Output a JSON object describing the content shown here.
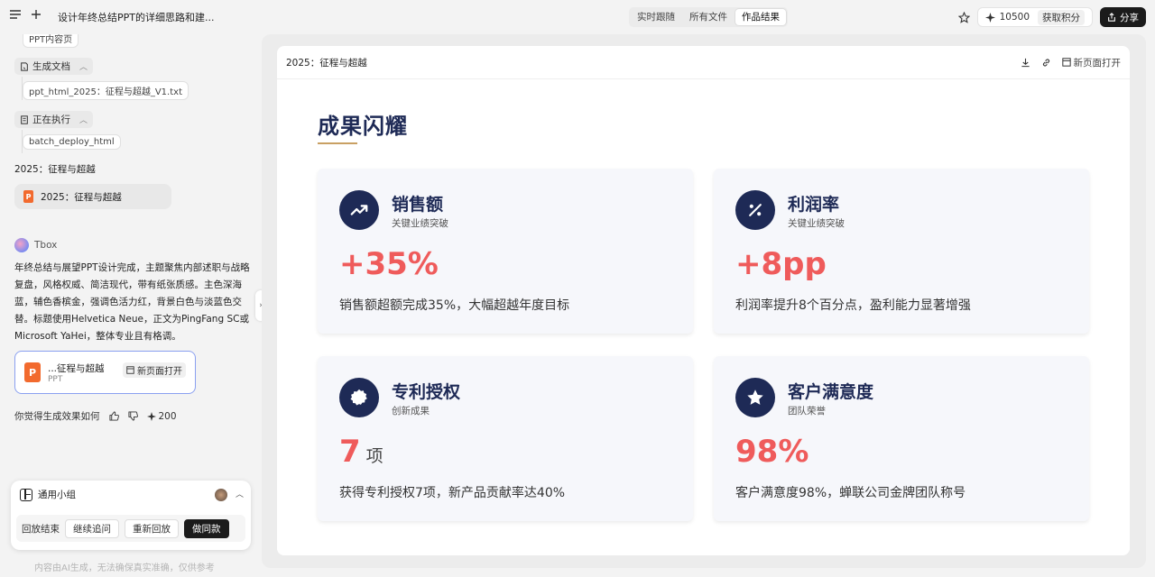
{
  "topbar": {
    "doc_title": "设计年终总结PPT的详细思路和建...",
    "tabs": [
      "实时跟随",
      "所有文件",
      "作品结果"
    ],
    "credits": "10500",
    "get_credits": "获取积分",
    "share": "分享"
  },
  "chat": {
    "top_chip": "PPT内容页",
    "step_generate": "生成文档",
    "generate_file": "ppt_html_2025：征程与超越_V1.txt",
    "step_running": "正在执行",
    "running_task": "batch_deploy_html",
    "subtitle": "2025：征程与超越",
    "ppt_item": "2025：征程与超越",
    "bot_name": "Tbox",
    "message": "年终总结与展望PPT设计完成，主题聚焦内部述职与战略复盘，风格权威、简洁现代，带有纸张质感。主色深海蓝，辅色香槟金，强调色活力红，背景白色与淡蓝色交替。标题使用Helvetica Neue，正文为PingFang SC或Microsoft YaHei，整体专业且有格调。",
    "card": {
      "name": "...征程与超越",
      "type": "PPT",
      "open": "新页面打开"
    },
    "feedback_q": "你觉得生成效果如何",
    "feedback_credits": "200",
    "replay": {
      "group": "通用小组",
      "label": "回放结束",
      "continue": "继续追问",
      "replay_again": "重新回放",
      "same": "做同款"
    },
    "disclaimer": "内容由AI生成，无法确保真实准确，仅供参考"
  },
  "viewer": {
    "title": "2025：征程与超越",
    "open_new": "新页面打开",
    "slide": {
      "heading": "成果闪耀",
      "cards": [
        {
          "name": "销售额",
          "sub": "关键业绩突破",
          "value": "+35%",
          "unit": "",
          "desc": "销售额超额完成35%，大幅超越年度目标",
          "icon": "trending-up-icon"
        },
        {
          "name": "利润率",
          "sub": "关键业绩突破",
          "value": "+8pp",
          "unit": "",
          "desc": "利润率提升8个百分点，盈利能力显著增强",
          "icon": "percent-icon"
        },
        {
          "name": "专利授权",
          "sub": "创新成果",
          "value": "7",
          "unit": "项",
          "desc": "获得专利授权7项，新产品贡献率达40%",
          "icon": "certificate-icon"
        },
        {
          "name": "客户满意度",
          "sub": "团队荣誉",
          "value": "98%",
          "unit": "",
          "desc": "客户满意度98%，蝉联公司金牌团队称号",
          "icon": "star-icon"
        }
      ]
    }
  },
  "colors": {
    "navy": "#1e2a56",
    "gold": "#c9a063",
    "red": "#ef5b5b"
  }
}
